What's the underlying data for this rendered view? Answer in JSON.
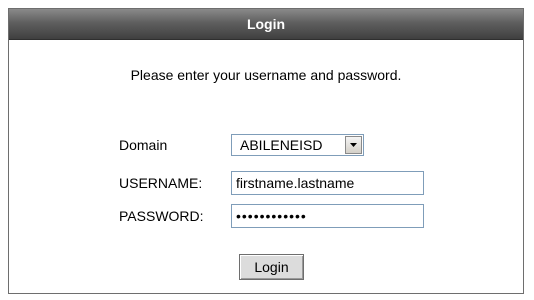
{
  "panel": {
    "title": "Login",
    "instructions": "Please enter your username and password."
  },
  "form": {
    "domain_label": "Domain",
    "domain_value": "ABILENEISD",
    "username_label": "USERNAME:",
    "username_value": "firstname.lastname",
    "password_label": "PASSWORD:",
    "password_value": "••••••••••••",
    "login_label": "Login"
  },
  "icons": {
    "dropdown": "chevron-down-icon"
  },
  "colors": {
    "titlebar": "#5f5f5f",
    "field_border": "#7f9db9",
    "button_bg": "#dcdcdc"
  }
}
